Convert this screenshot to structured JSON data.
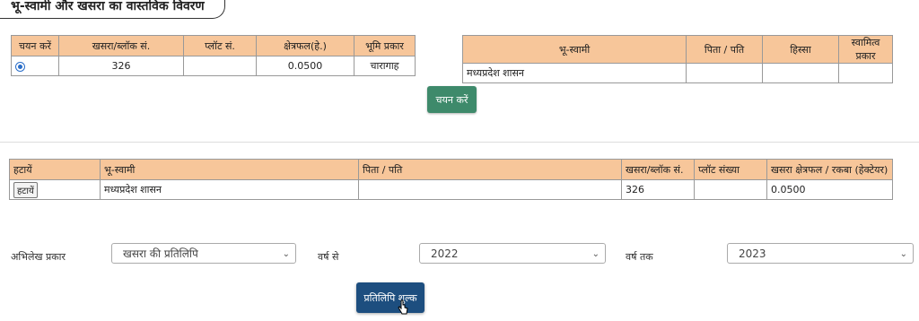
{
  "section_title": "भू-स्वामी और खसरा का वास्तविक विवरण",
  "khasra_table": {
    "headers": [
      "चयन करें",
      "खसरा/ब्लॉक सं.",
      "प्लॉट सं.",
      "क्षेत्रफल(हे.)",
      "भूमि प्रकार"
    ],
    "row": {
      "khasra": "326",
      "plot": "",
      "area": "0.0500",
      "land_type": "चारागाह"
    }
  },
  "owner_table": {
    "headers": [
      "भू-स्वामी",
      "पिता / पति",
      "हिस्सा",
      "स्वामित्व प्रकार"
    ],
    "row": {
      "owner": "मध्यप्रदेश शासन",
      "father": "",
      "share": "",
      "ownership": ""
    }
  },
  "select_button": "चयन करें",
  "selected_table": {
    "headers": [
      "हटायें",
      "भू-स्वामी",
      "पिता / पति",
      "खसरा/ब्लॉक सं.",
      "प्लॉट संख्या",
      "खसरा क्षेत्रफल / रकबा (हेक्टेयर)"
    ],
    "row": {
      "remove": "हटायें",
      "owner": "मध्यप्रदेश शासन",
      "father": "",
      "khasra": "326",
      "plot": "",
      "area": "0.0500"
    }
  },
  "filters": {
    "record_type_label": "अभिलेख प्रकार",
    "record_type_value": "खसरा की प्रतिलिपि",
    "year_from_label": "वर्ष से",
    "year_from_value": "2022",
    "year_to_label": "वर्ष तक",
    "year_to_value": "2023"
  },
  "submit_button": "प्रतिलिपि शुल्क",
  "colors": {
    "header_bg": "#f7c69a",
    "select_btn": "#3e8a6b",
    "submit_btn": "#1d4e7f"
  }
}
